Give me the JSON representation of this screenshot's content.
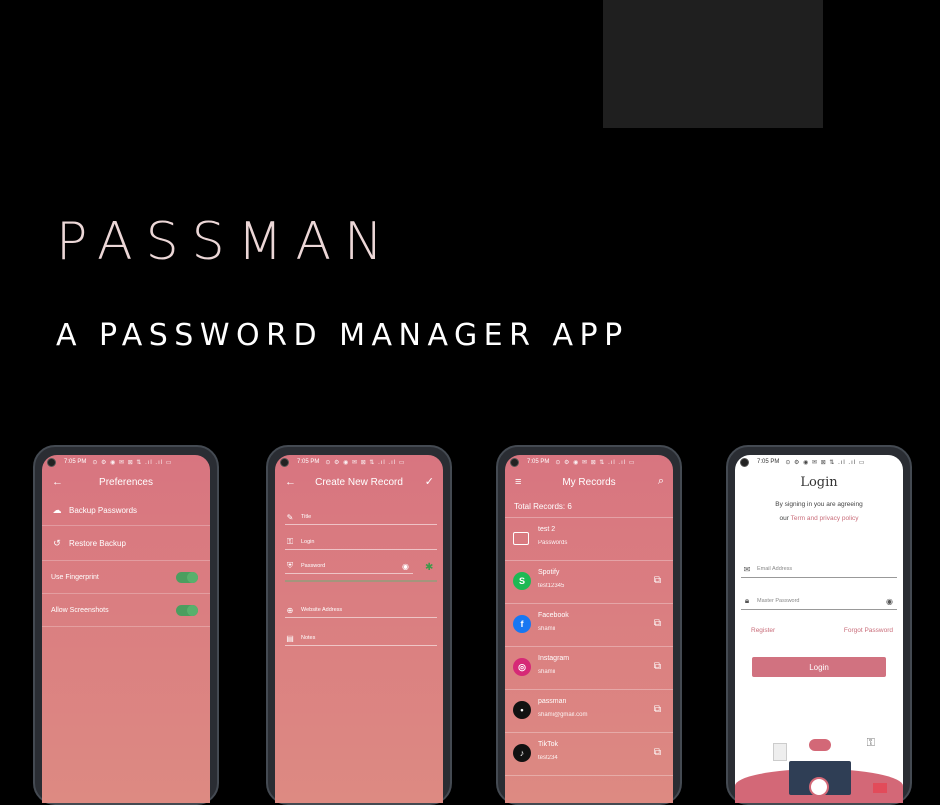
{
  "hero": {
    "title": "PASSMAN",
    "subtitle": "A PASSWORD MANAGER APP"
  },
  "status": {
    "time": "7:05 PM",
    "icons": "⊙ ⚙ ◉ ✉ ⊠ ⇅ .ıl .ıl ▭"
  },
  "accent": "#d87580",
  "phone1": {
    "title": "Preferences",
    "items": [
      {
        "icon": "cloud-upload-icon",
        "label": "Backup Passwords"
      },
      {
        "icon": "restore-icon",
        "label": "Restore Backup"
      },
      {
        "label": "Use Fingerprint",
        "toggle": true
      },
      {
        "label": "Allow Screenshots",
        "toggle": true
      }
    ]
  },
  "phone2": {
    "title": "Create New Record",
    "fields": [
      {
        "icon": "title-icon",
        "placeholder": "Title"
      },
      {
        "icon": "key-icon",
        "placeholder": "Login"
      },
      {
        "icon": "shield-icon",
        "placeholder": "Password"
      },
      {
        "icon": "globe-icon",
        "placeholder": "Website Address"
      },
      {
        "icon": "notes-icon",
        "placeholder": "Notes"
      }
    ]
  },
  "phone3": {
    "title": "My Records",
    "total": "Total Records: 6",
    "records": [
      {
        "name": "test 2",
        "sub": "Passwords",
        "logo": "folder",
        "color": "transparent"
      },
      {
        "name": "Spotify",
        "sub": "test12345",
        "logo": "S",
        "color": "#1db954"
      },
      {
        "name": "Facebook",
        "sub": "shamii",
        "logo": "f",
        "color": "#1877f2"
      },
      {
        "name": "Instagram",
        "sub": "shamii",
        "logo": "◎",
        "color": "#d62976"
      },
      {
        "name": "passman",
        "sub": "shami@gmail.com",
        "logo": "•",
        "color": "#111111"
      },
      {
        "name": "TikTok",
        "sub": "test234",
        "logo": "♪",
        "color": "#111111"
      }
    ]
  },
  "phone4": {
    "title": "Login",
    "agree1": "By signing in you are agreeing",
    "agree_prefix": "our",
    "agree_link": "Term and privacy policy",
    "email_placeholder": "Email Address",
    "password_placeholder": "Master Password",
    "register": "Register",
    "forgot": "Forgot Password",
    "login_button": "Login"
  }
}
